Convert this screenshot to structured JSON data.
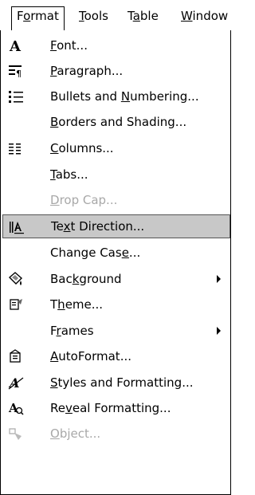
{
  "menubar": {
    "items": [
      {
        "pre": "F",
        "key": "o",
        "post": "rmat"
      },
      {
        "pre": "",
        "key": "T",
        "post": "ools"
      },
      {
        "pre": "T",
        "key": "a",
        "post": "ble"
      },
      {
        "pre": "",
        "key": "W",
        "post": "indow"
      }
    ]
  },
  "menu": {
    "items": [
      {
        "pre": "",
        "key": "F",
        "post": "ont...",
        "icon": "font-icon"
      },
      {
        "pre": "",
        "key": "P",
        "post": "aragraph...",
        "icon": "paragraph-icon"
      },
      {
        "pre": "Bullets and ",
        "key": "N",
        "post": "umbering...",
        "icon": "bullets-icon"
      },
      {
        "pre": "",
        "key": "B",
        "post": "orders and Shading...",
        "icon": ""
      },
      {
        "pre": "",
        "key": "C",
        "post": "olumns...",
        "icon": "columns-icon"
      },
      {
        "pre": "",
        "key": "T",
        "post": "abs...",
        "icon": ""
      },
      {
        "pre": "",
        "key": "D",
        "post": "rop Cap...",
        "icon": "",
        "disabled": true
      },
      {
        "pre": "Te",
        "key": "x",
        "post": "t Direction...",
        "icon": "text-direction-icon",
        "highlight": true
      },
      {
        "pre": "Change Cas",
        "key": "e",
        "post": "...",
        "icon": ""
      },
      {
        "pre": "Bac",
        "key": "k",
        "post": "ground",
        "icon": "background-icon",
        "submenu": true
      },
      {
        "pre": "T",
        "key": "h",
        "post": "eme...",
        "icon": "theme-icon"
      },
      {
        "pre": "F",
        "key": "r",
        "post": "ames",
        "icon": "",
        "submenu": true
      },
      {
        "pre": "",
        "key": "A",
        "post": "utoFormat...",
        "icon": "autoformat-icon"
      },
      {
        "pre": "",
        "key": "S",
        "post": "tyles and Formatting...",
        "icon": "styles-icon"
      },
      {
        "pre": "Re",
        "key": "v",
        "post": "eal Formatting...",
        "icon": "reveal-formatting-icon"
      },
      {
        "pre": "",
        "key": "O",
        "post": "bject...",
        "icon": "object-icon",
        "disabled": true
      }
    ]
  }
}
